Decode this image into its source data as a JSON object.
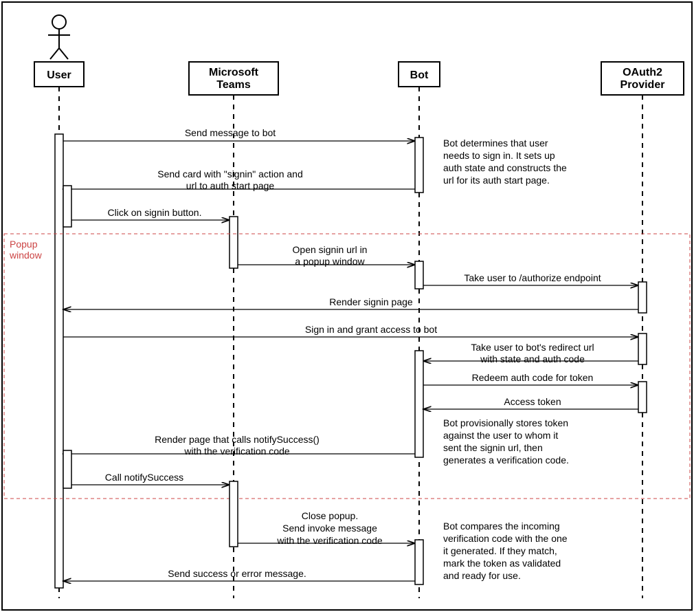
{
  "participants": {
    "user": "User",
    "teams": "Microsoft\nTeams",
    "bot": "Bot",
    "oauth": "OAuth2\nProvider"
  },
  "popup_label": "Popup\nwindow",
  "messages": {
    "m1": "Send message to bot",
    "m2a": "Send card with \"signin\" action and",
    "m2b": "url to auth start page",
    "m3": "Click on signin button.",
    "m4a": "Open signin url in",
    "m4b": "a popup window",
    "m5": "Take user to /authorize endpoint",
    "m6": "Render signin page",
    "m7": "Sign in and grant access to bot",
    "m8a": "Take user to bot's redirect url",
    "m8b": "with state and auth code",
    "m9": "Redeem auth code for token",
    "m10": "Access token",
    "m11a": "Render page that calls notifySuccess()",
    "m11b": "with the verification code",
    "m12": "Call notifySuccess",
    "m13a": "Close popup.",
    "m13b": "Send invoke message",
    "m13c": "with the verification code",
    "m14": "Send success or error message."
  },
  "notes": {
    "n1": [
      "Bot determines that user",
      "needs to sign in. It sets up",
      "auth state and constructs the",
      "url for its auth start page."
    ],
    "n2": [
      "Bot provisionally stores token",
      "against the user to whom it",
      "sent the signin url, then",
      "generates a verification code."
    ],
    "n3": [
      "Bot compares the incoming",
      "verification code with the one",
      "it generated. If they match,",
      "mark the token as validated",
      "and ready for use."
    ]
  }
}
